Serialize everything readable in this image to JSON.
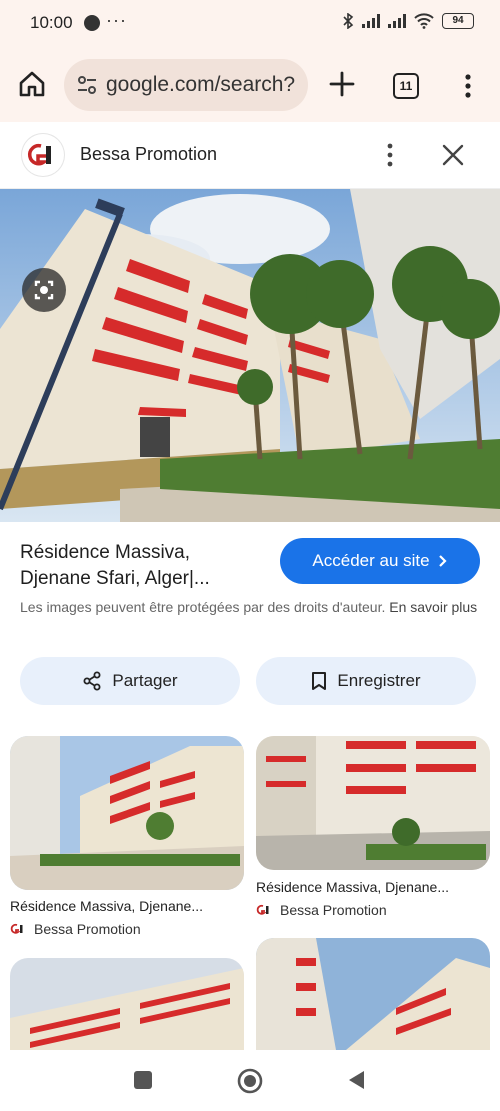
{
  "status_bar": {
    "time": "10:00",
    "battery": "94"
  },
  "browser": {
    "url": "google.com/search?",
    "tab_count": "11"
  },
  "site": {
    "name": "Bessa Promotion"
  },
  "result": {
    "title_line1": "Résidence Massiva,",
    "title_line2": "Djenane Sfari, Alger|...",
    "visit_button": "Accéder au site",
    "copyright_text": "Les images peuvent être protégées par des droits d'auteur.",
    "learn_more": "En savoir plus",
    "share_label": "Partager",
    "save_label": "Enregistrer"
  },
  "related": [
    {
      "caption": "Résidence Massiva, Djenane...",
      "source": "Bessa Promotion"
    },
    {
      "caption": "Résidence Massiva, Djenane...",
      "source": "Bessa Promotion"
    }
  ],
  "colors": {
    "accent": "#1a73e8",
    "brand_red": "#d62b2b",
    "toolbar_bg": "#fdf3ee"
  }
}
